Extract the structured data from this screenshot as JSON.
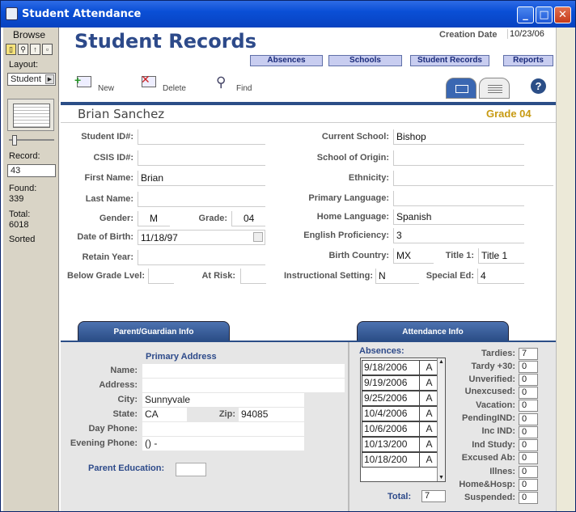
{
  "window": {
    "title": "Student Attendance"
  },
  "sidebar": {
    "mode": "Browse",
    "layout_label": "Layout:",
    "layout_value": "Student",
    "record_label": "Record:",
    "record_value": "43",
    "found_label": "Found:",
    "found_value": "339",
    "total_label": "Total:",
    "total_value": "6018",
    "sort_status": "Sorted"
  },
  "header": {
    "title": "Student Records",
    "creation_date_label": "Creation Date",
    "creation_date_value": "10/23/06",
    "tabs": [
      "Absences",
      "Schools",
      "Student Records",
      "Reports"
    ]
  },
  "toolbar": {
    "new_label": "New",
    "delete_label": "Delete",
    "find_label": "Find"
  },
  "student": {
    "name": "Brian Sanchez",
    "grade_badge": "Grade 04"
  },
  "fields_left": [
    {
      "label": "Student ID#:",
      "value": ""
    },
    {
      "label": "CSIS ID#:",
      "value": ""
    },
    {
      "label": "First Name:",
      "value": "Brian"
    },
    {
      "label": "Last Name:",
      "value": ""
    },
    {
      "label": "Gender:",
      "value": "M"
    },
    {
      "label": "Grade:",
      "value": "04"
    },
    {
      "label": "Date of Birth:",
      "value": "11/18/97"
    },
    {
      "label": "Retain Year:",
      "value": ""
    },
    {
      "label": "Below Grade Lvel:",
      "value": ""
    },
    {
      "label": "At Risk:",
      "value": ""
    }
  ],
  "fields_right": [
    {
      "label": "Current School:",
      "value": "Bishop"
    },
    {
      "label": "School of Origin:",
      "value": ""
    },
    {
      "label": "Ethnicity:",
      "value": ""
    },
    {
      "label": "Primary Language:",
      "value": ""
    },
    {
      "label": "Home Language:",
      "value": "Spanish"
    },
    {
      "label": "English Proficiency:",
      "value": "3"
    },
    {
      "label": "Birth Country:",
      "value": "MX"
    },
    {
      "label": "Title 1:",
      "value": "Title 1"
    },
    {
      "label": "Instructional Setting:",
      "value": "N"
    },
    {
      "label": "Special Ed:",
      "value": "4"
    }
  ],
  "sections": {
    "parent": "Parent/Guardian Info",
    "attendance": "Attendance Info"
  },
  "guardian": {
    "primary_address_label": "Primary Address",
    "name_label": "Name:",
    "name_value": "",
    "address_label": "Address:",
    "address_value": "",
    "city_label": "City:",
    "city_value": "Sunnyvale",
    "state_label": "State:",
    "state_value": "CA",
    "zip_label": "Zip:",
    "zip_value": "94085",
    "day_phone_label": "Day Phone:",
    "day_phone_value": "",
    "evening_phone_label": "Evening Phone:",
    "evening_phone_value": "() -",
    "parent_education_label": "Parent Education:",
    "parent_education_value": ""
  },
  "absences": {
    "label": "Absences:",
    "rows": [
      {
        "date": "9/18/2006",
        "code": "A"
      },
      {
        "date": "9/19/2006",
        "code": "A"
      },
      {
        "date": "9/25/2006",
        "code": "A"
      },
      {
        "date": "10/4/2006",
        "code": "A"
      },
      {
        "date": "10/6/2006",
        "code": "A"
      },
      {
        "date": "10/13/200",
        "code": "A"
      },
      {
        "date": "10/18/200",
        "code": "A"
      }
    ],
    "total_label": "Total:",
    "total_value": "7"
  },
  "counts": [
    {
      "label": "Tardies:",
      "value": "7"
    },
    {
      "label": "Tardy +30:",
      "value": "0"
    },
    {
      "label": "Unverified:",
      "value": "0"
    },
    {
      "label": "Unexcused:",
      "value": "0"
    },
    {
      "label": "Vacation:",
      "value": "0"
    },
    {
      "label": "PendingIND:",
      "value": "0"
    },
    {
      "label": "Inc IND:",
      "value": "0"
    },
    {
      "label": "Ind Study:",
      "value": "0"
    },
    {
      "label": "Excused Ab:",
      "value": "0"
    },
    {
      "label": "Illnes:",
      "value": "0"
    },
    {
      "label": "Home&Hosp:",
      "value": "0"
    },
    {
      "label": "Suspended:",
      "value": "0"
    }
  ]
}
